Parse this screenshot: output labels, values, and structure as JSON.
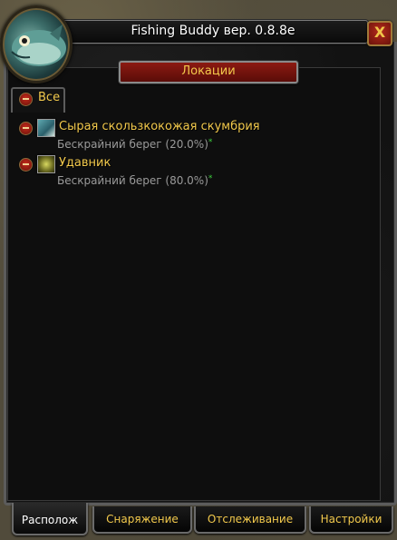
{
  "window": {
    "title": "Fishing Buddy вер. 0.8.8e",
    "close_label": "X"
  },
  "toolbar": {
    "locations_button": "Локации"
  },
  "group": {
    "label": "Все"
  },
  "items": [
    {
      "name": "Сырая скользкокожая скумбрия",
      "location": "Бескрайний берег (20.0%)",
      "icon": "fish-icon"
    },
    {
      "name": "Удавник",
      "location": "Бескрайний берег (80.0%)",
      "icon": "seaweed-icon"
    }
  ],
  "tabs": [
    {
      "label": "Располож",
      "active": true
    },
    {
      "label": "Снаряжение",
      "active": false
    },
    {
      "label": "Отслеживание",
      "active": false
    },
    {
      "label": "Настройки",
      "active": false
    }
  ],
  "colors": {
    "gold_text": "#f2c94c",
    "grey_text": "#9a9a9a",
    "star_green": "#3fd13f",
    "button_red": "#8c1a12"
  }
}
